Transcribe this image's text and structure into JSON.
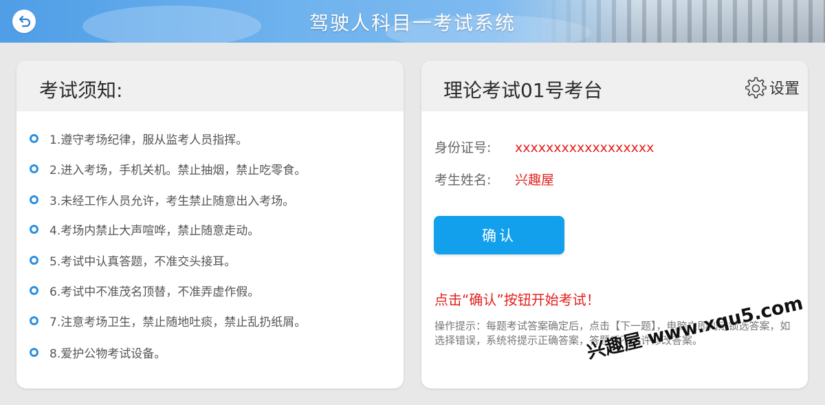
{
  "header": {
    "title": "驾驶人科目一考试系统",
    "back_icon": "back-arrow-icon"
  },
  "notice": {
    "heading": "考试须知:",
    "rules": [
      "1.遵守考场纪律，服从监考人员指挥。",
      "2.进入考场，手机关机。禁止抽烟，禁止吃零食。",
      "3.未经工作人员允许，考生禁止随意出入考场。",
      "4.考场内禁止大声喧哗，禁止随意走动。",
      "5.考试中认真答题，不准交头接耳。",
      "6.考试中不准茂名顶替，不准弄虚作假。",
      "7.注意考场卫生，禁止随地吐痰，禁止乱扔纸屑。",
      "8.爱护公物考试设备。"
    ]
  },
  "exam": {
    "heading": "理论考试01号考台",
    "settings_label": "设置",
    "settings_icon": "gear-icon",
    "id_label": "身份证号:",
    "id_value": "xxxxxxxxxxxxxxxxxx",
    "name_label": "考生姓名:",
    "name_value": "兴趣屋",
    "confirm_label": "确认",
    "prompt": "点击“确认”按钮开始考试！",
    "hint": "操作提示：每题考试答案确定后，点击【下一题】，电脑立即判定锁选答案，如选择错误，系统将提示正确答案，答题后不允许修改答案。"
  },
  "watermark": "兴趣屋 www.xqu5.com",
  "colors": {
    "accent_blue": "#12a0ec",
    "alert_red": "#e3201c",
    "bullet_blue": "#2a8fe0"
  }
}
